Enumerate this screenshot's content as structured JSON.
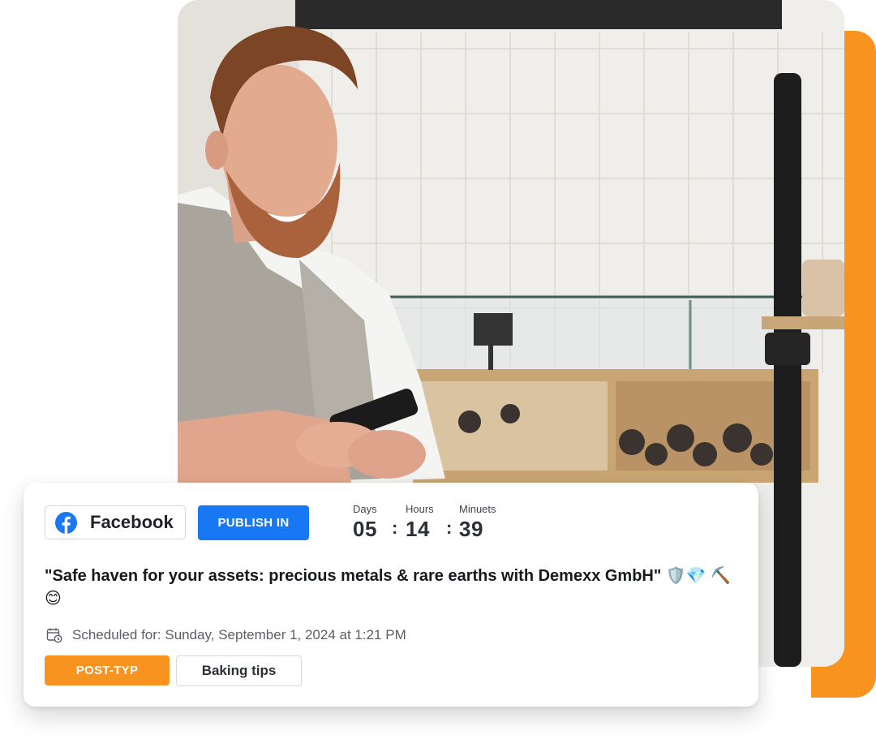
{
  "colors": {
    "accent_orange": "#F7931E",
    "facebook_blue": "#1877F2",
    "text_dark": "#16191d",
    "text_muted": "#5a5f66"
  },
  "photo": {
    "alt_semantic": "baker-with-phone-photo"
  },
  "post": {
    "platform": {
      "label": "Facebook",
      "icon": "facebook-icon"
    },
    "publish_label": "PUBLISH IN",
    "countdown": {
      "days_label": "Days",
      "days_value": "05",
      "hours_label": "Hours",
      "hours_value": "14",
      "minutes_label": "Minuets",
      "minutes_value": "39",
      "separator": ":"
    },
    "title": "\"Safe haven for your assets: precious metals & rare earths with Demexx GmbH\" 🛡️💎 ⛏️😊",
    "schedule": {
      "icon": "calendar-clock-icon",
      "text": "Scheduled for: Sunday, September 1, 2024 at 1:21 PM"
    },
    "post_type_label": "POST-TYP",
    "tag_label": "Baking tips"
  }
}
